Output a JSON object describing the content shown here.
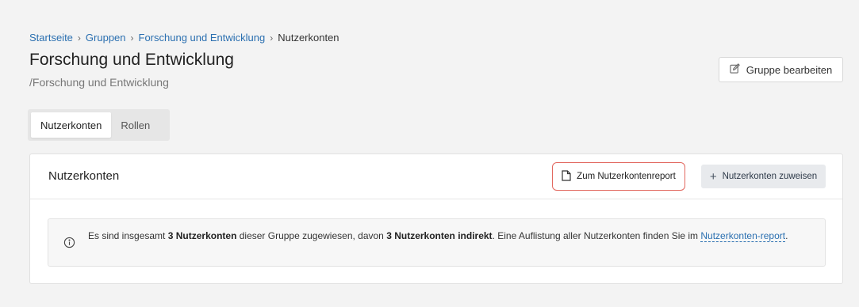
{
  "breadcrumb": {
    "items": [
      "Startseite",
      "Gruppen",
      "Forschung und Entwicklung"
    ],
    "current": "Nutzerkonten",
    "separator": "›"
  },
  "header": {
    "title": "Forschung und Entwicklung",
    "path": "/Forschung und Entwicklung",
    "edit_button_label": "Gruppe bearbeiten"
  },
  "tabs": [
    {
      "label": "Nutzerkonten",
      "active": true
    },
    {
      "label": "Rollen",
      "active": false
    }
  ],
  "card": {
    "title": "Nutzerkonten",
    "report_button_label": "Zum Nutzerkontenreport",
    "assign_button_label": "Nutzerkonten zuweisen",
    "info": {
      "part1": "Es sind insgesamt ",
      "bold1": "3 Nutzerkonten",
      "part2": " dieser Gruppe zugewiesen, davon ",
      "bold2": "3 Nutzerkonten indirekt",
      "part3": ". Eine Auflistung aller Nutzerkonten finden Sie im ",
      "link": "Nutzerkonten-report",
      "part4": "."
    }
  },
  "colors": {
    "link": "#2a6fb0",
    "highlight_border": "#e2685f",
    "background": "#f3f3f3"
  },
  "icons": {
    "edit": "edit-icon",
    "document": "document-icon",
    "plus": "plus-icon",
    "info": "info-icon"
  }
}
